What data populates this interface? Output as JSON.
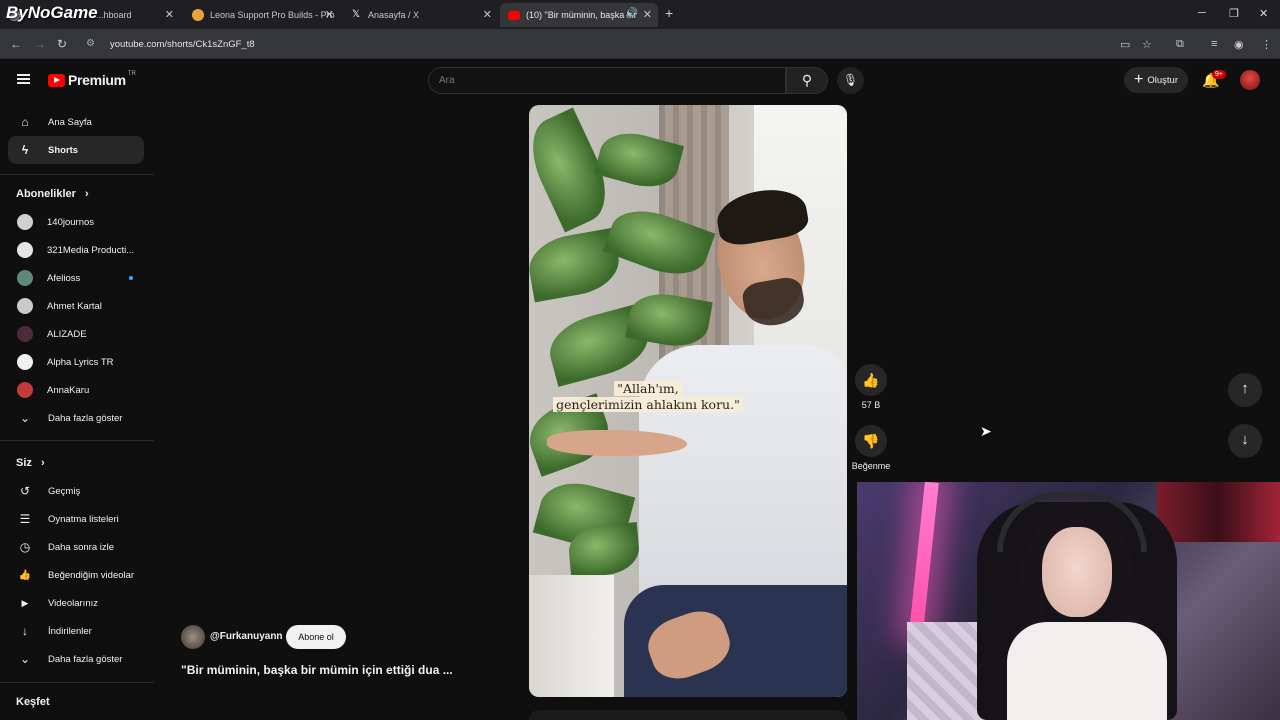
{
  "browser": {
    "watermark": "ByNoGame",
    "tabs": [
      {
        "title": "...hboard",
        "favicon_color": "#888888"
      },
      {
        "title": "Leona Support Pro Builds - Pro",
        "favicon_color": "#e8a33c"
      },
      {
        "title": "Anasayfa / X",
        "favicon_color": "#ffffff"
      },
      {
        "title": "(10) \"Bir müminin, başka bir",
        "favicon_color": "#ff0000"
      }
    ],
    "new_tab": "+",
    "url": "youtube.com/shorts/Ck1sZnGF_t8"
  },
  "header": {
    "logo_text": "Premium",
    "logo_region": "TR",
    "search_placeholder": "Ara",
    "create_label": "Oluştur",
    "notif_badge": "9+"
  },
  "sidebar": {
    "main": [
      {
        "label": "Ana Sayfa",
        "icon": "home-icon",
        "glyph": "⌂"
      },
      {
        "label": "Shorts",
        "icon": "shorts-icon",
        "glyph": "ϟ"
      }
    ],
    "subs_heading": "Abonelikler",
    "subscriptions": [
      {
        "label": "140journos",
        "color": "#d0d0d0",
        "dot": false
      },
      {
        "label": "321Media Producti...",
        "color": "#e5e5e5",
        "dot": false
      },
      {
        "label": "Afelioss",
        "color": "#5f8a7a",
        "dot": true
      },
      {
        "label": "Ahmet Kartal",
        "color": "#c9c9c9",
        "dot": false
      },
      {
        "label": "ALIZADE",
        "color": "#4a2c3c",
        "dot": false
      },
      {
        "label": "Alpha Lyrics TR",
        "color": "#f0f0f0",
        "dot": false
      },
      {
        "label": "AnnaKaru",
        "color": "#c43a3a",
        "dot": false
      }
    ],
    "subs_more": "Daha fazla göster",
    "you_heading": "Siz",
    "you_items": [
      {
        "label": "Geçmiş",
        "icon": "history-icon",
        "glyph": "↺"
      },
      {
        "label": "Oynatma listeleri",
        "icon": "playlists-icon",
        "glyph": "☰"
      },
      {
        "label": "Daha sonra izle",
        "icon": "watch-later-icon",
        "glyph": "◷"
      },
      {
        "label": "Beğendiğim videolar",
        "icon": "liked-videos-icon",
        "glyph": "👍"
      },
      {
        "label": "Videolarınız",
        "icon": "your-videos-icon",
        "glyph": "▶"
      },
      {
        "label": "İndirilenler",
        "icon": "downloads-icon",
        "glyph": "↓"
      }
    ],
    "you_more": "Daha fazla göster",
    "explore_heading": "Keşfet"
  },
  "short": {
    "caption_line1": "\"Allah'ım,",
    "caption_line2": "gençlerimizin ahlakını koru.\"",
    "likes": "57 B",
    "dislike_label": "Beğenme",
    "channel": "@Furkanuyann",
    "subscribe_label": "Abone ol",
    "title": "\"Bir müminin, başka bir mümin için ettiği dua ..."
  }
}
